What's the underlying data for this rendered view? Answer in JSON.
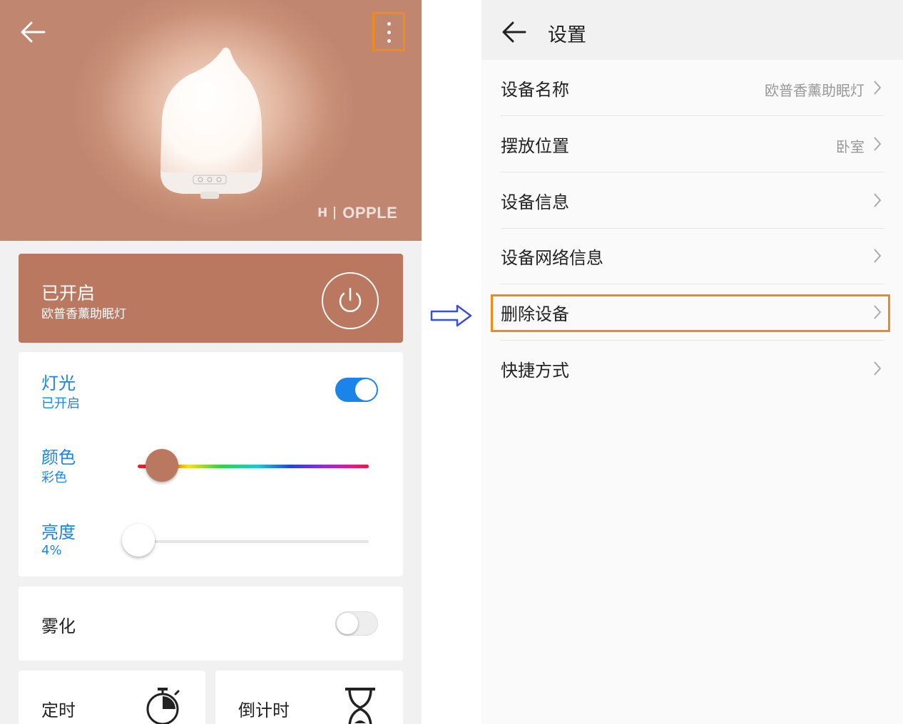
{
  "left_screen": {
    "brand": {
      "mark": "H",
      "name": "OPPLE"
    },
    "status": {
      "title": "已开启",
      "device_name": "欧普香薰助眠灯"
    },
    "light": {
      "label": "灯光",
      "state": "已开启",
      "toggle_on": true
    },
    "color": {
      "label": "颜色",
      "value": "彩色"
    },
    "brightness": {
      "label": "亮度",
      "value": "4%",
      "level": 0.04
    },
    "mist": {
      "label": "雾化",
      "toggle_on": false
    },
    "timer": {
      "label": "定时"
    },
    "countdown": {
      "label": "倒计时"
    },
    "colors": {
      "accent": "#b9785f",
      "blue": "#1a84e8",
      "highlight": "#f08a1c"
    }
  },
  "right_screen": {
    "title": "设置",
    "rows": [
      {
        "label": "设备名称",
        "value": "欧普香薰助眠灯"
      },
      {
        "label": "摆放位置",
        "value": "卧室"
      },
      {
        "label": "设备信息",
        "value": ""
      },
      {
        "label": "设备网络信息",
        "value": ""
      },
      {
        "label": "删除设备",
        "value": ""
      },
      {
        "label": "快捷方式",
        "value": ""
      }
    ]
  },
  "icons": [
    "back-arrow-icon",
    "more-vertical-icon",
    "power-icon",
    "stopwatch-icon",
    "hourglass-icon",
    "chevron-right-icon",
    "flow-arrow-icon"
  ]
}
